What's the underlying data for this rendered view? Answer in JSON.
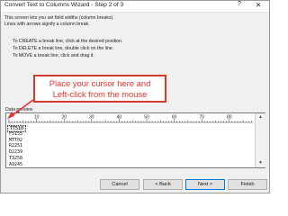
{
  "window": {
    "title": "Convert Text to Columns Wizard - Step 2 of 3",
    "help_label": "?",
    "close_label": "✕"
  },
  "intro": {
    "line1": "This screen lets you set field widths (column breaks).",
    "line2": "Lines with arrows signify a column break."
  },
  "instructions": [
    "To CREATE a break line, click at the desired position.",
    "To DELETE a break line, double click on the line.",
    "To MOVE a break line, click and drag it."
  ],
  "callout": {
    "line1": "Place your cursor here and",
    "line2": "Left-click from the mouse",
    "color": "#e8322b"
  },
  "preview": {
    "label_prefix": "Data ",
    "label_underlined": "p",
    "label_suffix": "review",
    "ruler_ticks": [
      "10",
      "20",
      "30",
      "40",
      "50",
      "60",
      "70",
      "80"
    ],
    "rows": [
      "TT510",
      "F5155",
      "MTT02",
      "R2251",
      "D2239",
      "T3258",
      "A9245"
    ]
  },
  "buttons": {
    "cancel": "Cancel",
    "back": "< Back",
    "next": "Next >",
    "finish": "Finish"
  }
}
